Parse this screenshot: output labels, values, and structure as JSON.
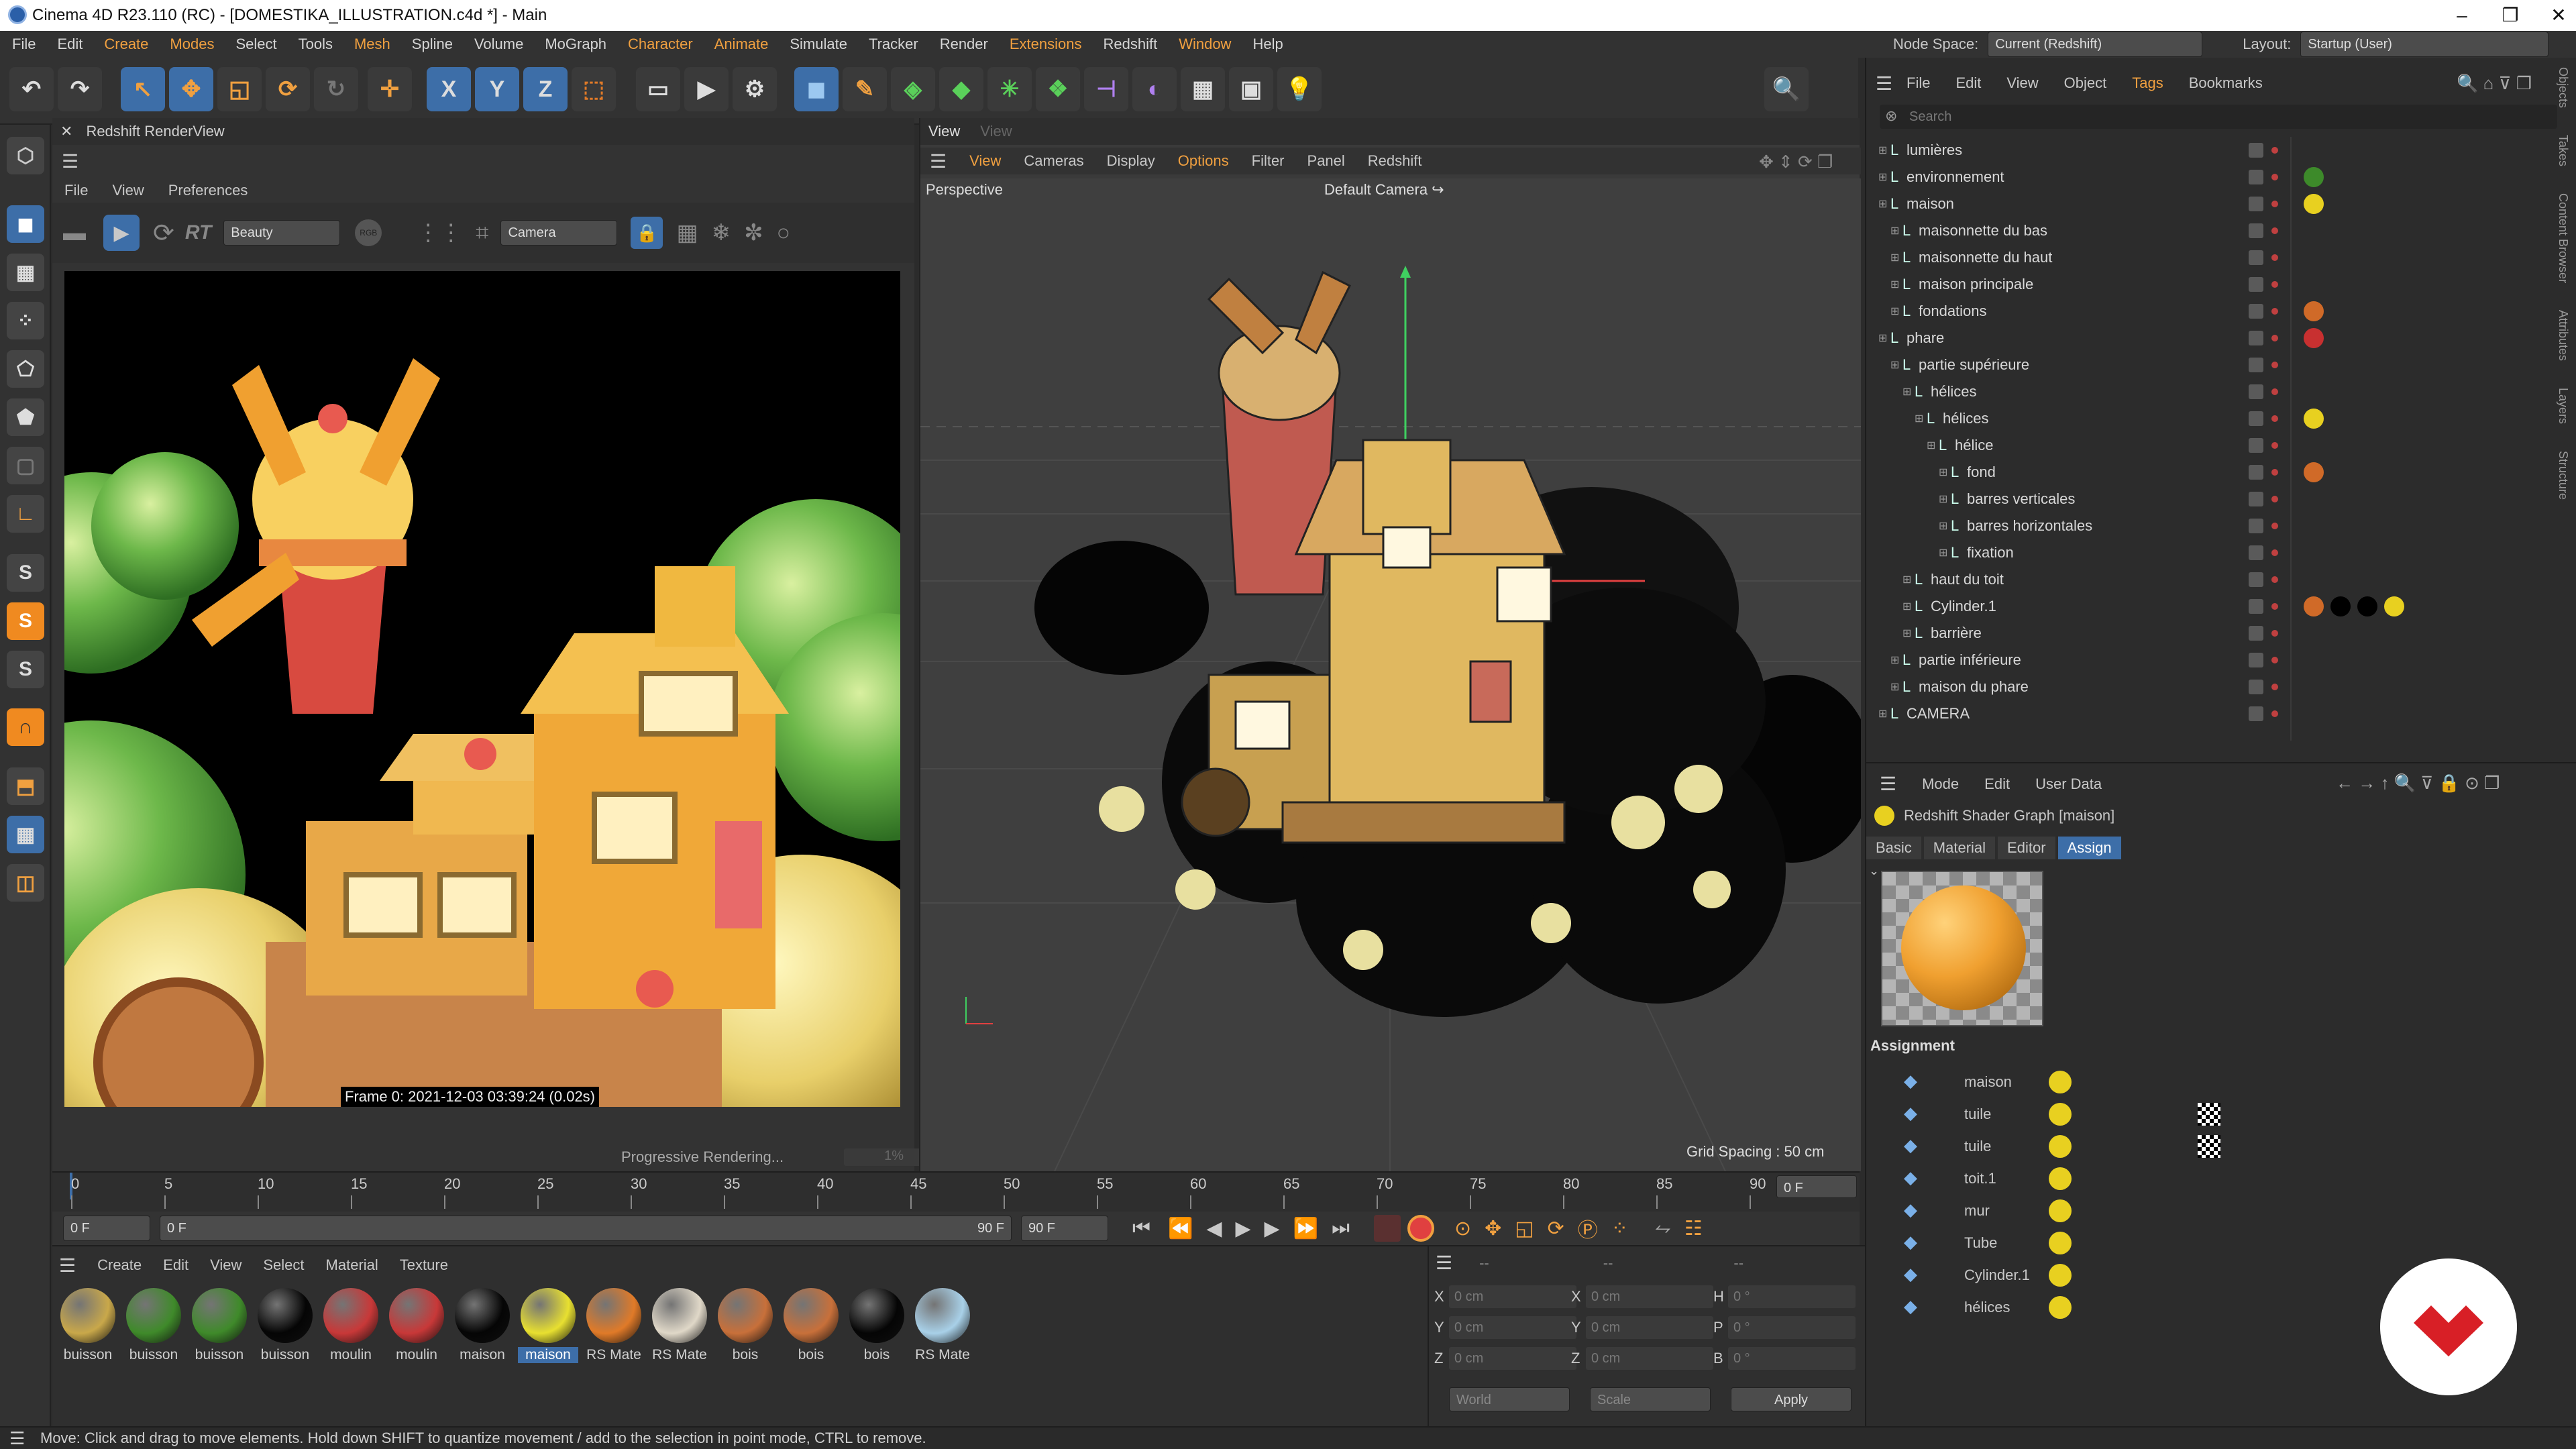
{
  "window": {
    "title": "Cinema 4D R23.110 (RC) - [DOMESTIKA_ILLUSTRATION.c4d *] - Main"
  },
  "menubar": [
    "File",
    "Edit",
    "Create",
    "Modes",
    "Select",
    "Tools",
    "Mesh",
    "Spline",
    "Volume",
    "MoGraph",
    "Character",
    "Animate",
    "Simulate",
    "Tracker",
    "Render",
    "Extensions",
    "Redshift",
    "Window",
    "Help"
  ],
  "highlight_menus": [
    "Create",
    "Modes",
    "Mesh",
    "Character",
    "Animate",
    "Extensions",
    "Window"
  ],
  "nodespace": {
    "label": "Node Space:",
    "value": "Current (Redshift)",
    "layout_label": "Layout:",
    "layout_value": "Startup (User)"
  },
  "renderview": {
    "title": "Redshift RenderView",
    "menus": [
      "File",
      "View",
      "Preferences"
    ],
    "aov": "Beauty",
    "rgb": "RGB",
    "rt": "RT",
    "camera": "Camera",
    "frame_info": "Frame 0:  2021-12-03  03:39:24  (0.02s)",
    "progress_label": "Progressive Rendering...",
    "progress_value": "1%"
  },
  "viewport": {
    "tabs": [
      "View",
      "View"
    ],
    "menus": [
      "View",
      "Cameras",
      "Display",
      "Options",
      "Filter",
      "Panel",
      "Redshift"
    ],
    "label": "Perspective",
    "camera": "Default Camera",
    "grid_spacing": "Grid Spacing : 50 cm"
  },
  "objects": {
    "menus": [
      "File",
      "Edit",
      "View",
      "Object",
      "Tags",
      "Bookmarks"
    ],
    "search_placeholder": "Search",
    "items": [
      {
        "name": "lumières",
        "indent": 0
      },
      {
        "name": "environnement",
        "indent": 0,
        "tags": [
          "#3d8a2a"
        ]
      },
      {
        "name": "maison",
        "indent": 0,
        "tags": [
          "#e8d020"
        ]
      },
      {
        "name": "maisonnette du bas",
        "indent": 1
      },
      {
        "name": "maisonnette du haut",
        "indent": 1
      },
      {
        "name": "maison principale",
        "indent": 1
      },
      {
        "name": "fondations",
        "indent": 1,
        "tags": [
          "#d06a28"
        ]
      },
      {
        "name": "phare",
        "indent": 0,
        "tags": [
          "#c83030"
        ]
      },
      {
        "name": "partie supérieure",
        "indent": 1
      },
      {
        "name": "hélices",
        "indent": 2
      },
      {
        "name": "hélices",
        "indent": 3,
        "tags": [
          "#e8d020"
        ]
      },
      {
        "name": "hélice",
        "indent": 4
      },
      {
        "name": "fond",
        "indent": 5,
        "tags": [
          "#d06a28"
        ]
      },
      {
        "name": "barres verticales",
        "indent": 5
      },
      {
        "name": "barres horizontales",
        "indent": 5
      },
      {
        "name": "fixation",
        "indent": 5
      },
      {
        "name": "haut du toit",
        "indent": 2
      },
      {
        "name": "Cylinder.1",
        "indent": 2,
        "tags": [
          "#d06a28",
          "#000000",
          "#000000",
          "#e8d020"
        ]
      },
      {
        "name": "barrière",
        "indent": 2
      },
      {
        "name": "partie inférieure",
        "indent": 1
      },
      {
        "name": "maison du phare",
        "indent": 1
      },
      {
        "name": "CAMERA",
        "indent": 0
      }
    ]
  },
  "attributes": {
    "menus": [
      "Mode",
      "Edit",
      "User Data"
    ],
    "title": "Redshift Shader Graph [maison]",
    "tabs": [
      "Basic",
      "Material",
      "Editor",
      "Assign"
    ],
    "active_tab": "Assign",
    "assignment_label": "Assignment",
    "assignments": [
      "maison",
      "tuile",
      "tuile",
      "toit.1",
      "mur",
      "Tube",
      "Cylinder.1",
      "hélices"
    ]
  },
  "timeline": {
    "ticks": [
      "0",
      "5",
      "10",
      "15",
      "20",
      "25",
      "30",
      "35",
      "40",
      "45",
      "50",
      "55",
      "60",
      "65",
      "70",
      "75",
      "80",
      "85",
      "90"
    ],
    "current_frame": "0 F",
    "start": "0 F",
    "start2": "0 F",
    "end": "90 F",
    "end2": "90 F",
    "right_frame": "0 F"
  },
  "materials": {
    "menus": [
      "Create",
      "Edit",
      "View",
      "Select",
      "Material",
      "Texture"
    ],
    "items": [
      {
        "name": "buisson",
        "color": "#c9a84a"
      },
      {
        "name": "buisson",
        "color": "#3f8a2a"
      },
      {
        "name": "buisson",
        "color": "#3f8a2a"
      },
      {
        "name": "buisson",
        "color": "#050505"
      },
      {
        "name": "moulin",
        "color": "#c83838"
      },
      {
        "name": "moulin",
        "color": "#c83838"
      },
      {
        "name": "maison",
        "color": "#050505"
      },
      {
        "name": "maison",
        "color": "#e8e030",
        "selected": true
      },
      {
        "name": "RS Mate",
        "color": "#e07a28"
      },
      {
        "name": "RS Mate",
        "color": "#e0d8c8"
      },
      {
        "name": "bois",
        "color": "#c8703a"
      },
      {
        "name": "bois",
        "color": "#c8703a"
      },
      {
        "name": "bois",
        "color": "#050505"
      },
      {
        "name": "RS Mate",
        "color": "#a8d0e8"
      }
    ]
  },
  "coords": {
    "rows": [
      {
        "a": "X",
        "v1": "0 cm",
        "b": "X",
        "v2": "0 cm",
        "c": "H",
        "v3": "0 °"
      },
      {
        "a": "Y",
        "v1": "0 cm",
        "b": "Y",
        "v2": "0 cm",
        "c": "P",
        "v3": "0 °"
      },
      {
        "a": "Z",
        "v1": "0 cm",
        "b": "Z",
        "v2": "0 cm",
        "c": "B",
        "v3": "0 °"
      }
    ],
    "world": "World",
    "scale": "Scale",
    "apply": "Apply",
    "dashes": [
      "--",
      "--",
      "--"
    ]
  },
  "status": "Move: Click and drag to move elements. Hold down SHIFT to quantize movement / add to the selection in point mode, CTRL to remove.",
  "sidetabs": [
    "Objects",
    "Takes",
    "Content Browser",
    "Attributes",
    "Layers",
    "Structure"
  ],
  "colors": {
    "accent": "#3d6ea8",
    "highlight": "#f0a040",
    "logo": "#d81f26"
  }
}
